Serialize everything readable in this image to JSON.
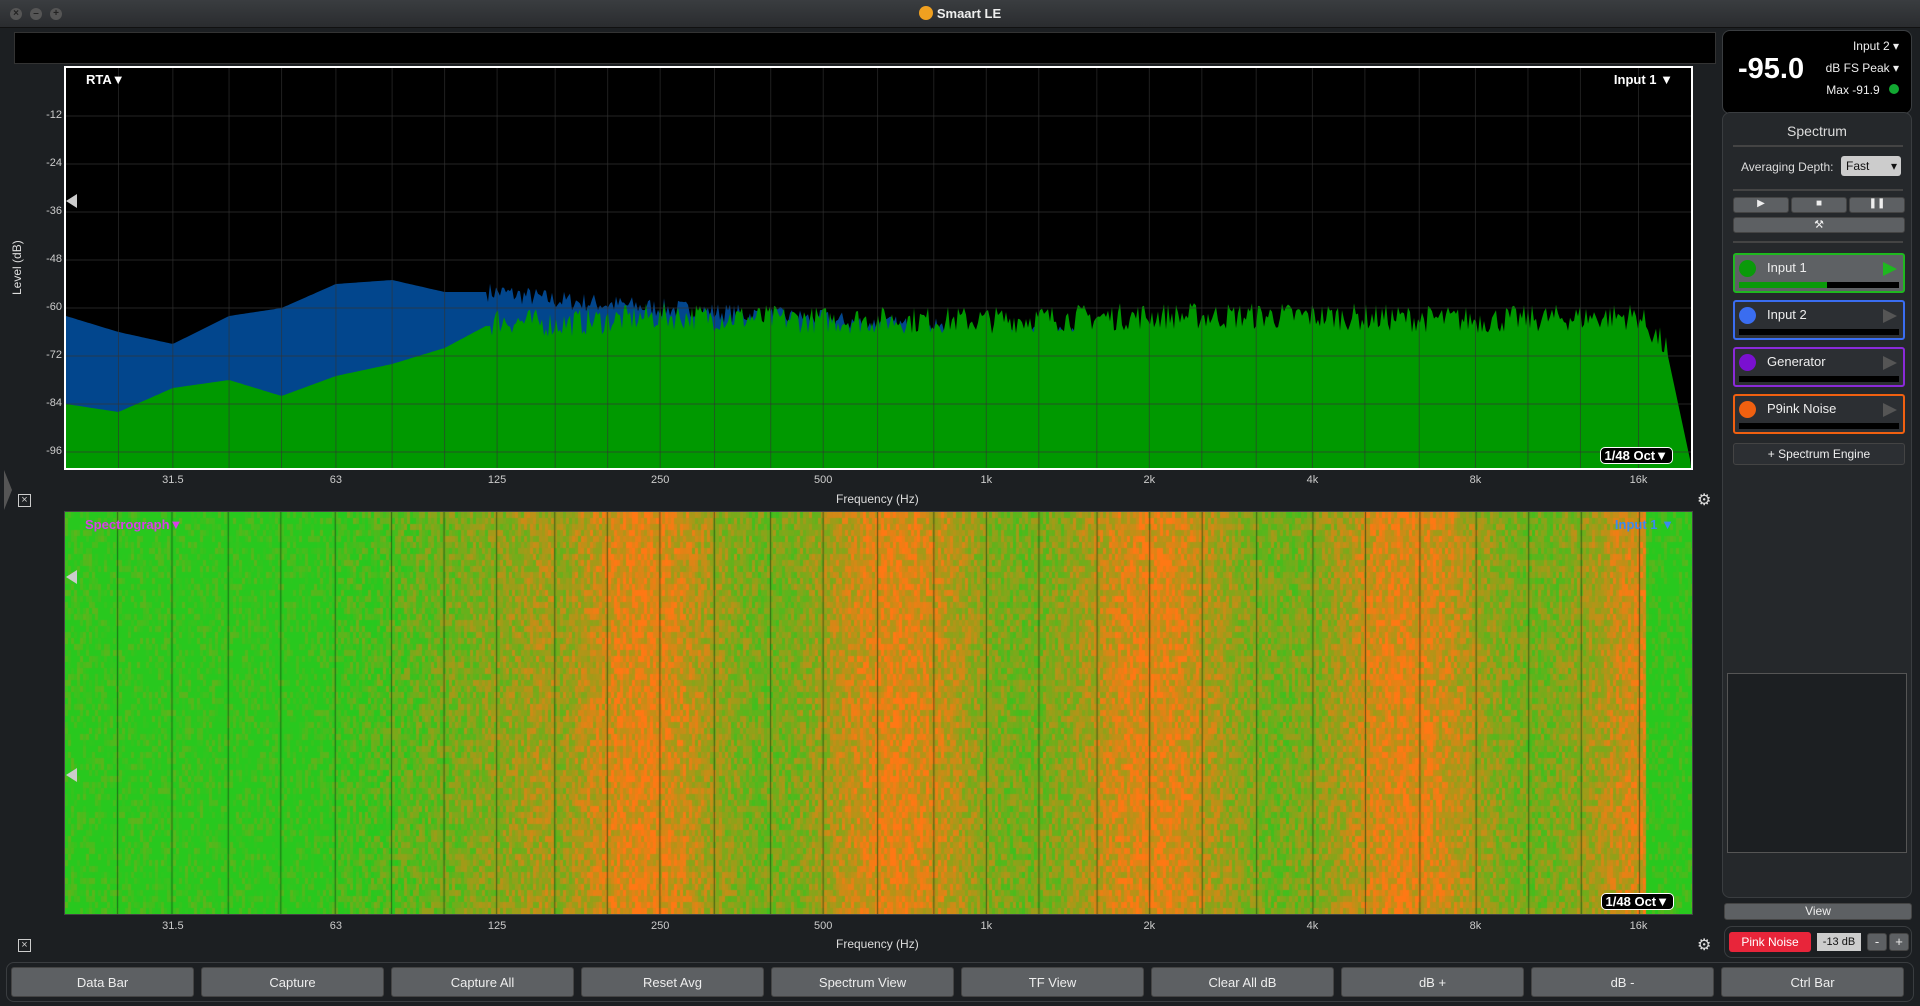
{
  "window": {
    "title": "Smaart LE"
  },
  "rta": {
    "mode_label": "RTA▼",
    "input_label": "Input 1 ▼",
    "resolution": "1/48 Oct▼",
    "ylabel": "Level (dB)",
    "xlabel": "Frequency (Hz)",
    "yticks": [
      "-12",
      "-24",
      "-36",
      "-48",
      "-60",
      "-72",
      "-84",
      "-96"
    ],
    "xticks": [
      "31.5",
      "63",
      "125",
      "250",
      "500",
      "1k",
      "2k",
      "4k",
      "8k",
      "16k"
    ]
  },
  "spectrograph": {
    "mode_label": "Spectrograph▼",
    "input_label": "Input 1 ▼",
    "resolution": "1/48 Oct▼",
    "xlabel": "Frequency (Hz)"
  },
  "chart_data": {
    "type": "area",
    "xlabel": "Frequency (Hz)",
    "ylabel": "Level (dB)",
    "xscale": "log",
    "xlim": [
      20,
      20000
    ],
    "ylim": [
      -100,
      0
    ],
    "grid": true,
    "x": [
      20,
      25,
      31.5,
      40,
      50,
      63,
      80,
      100,
      125,
      160,
      250,
      500,
      1000,
      2000,
      4000,
      8000,
      16000,
      18000,
      20000
    ],
    "series": [
      {
        "name": "Input 1",
        "color": "#009900",
        "values": [
          -84,
          -86,
          -80,
          -78,
          -82,
          -77,
          -74,
          -70,
          -63,
          -64,
          -62,
          -63,
          -63,
          -62,
          -62,
          -63,
          -62,
          -70,
          -99
        ]
      },
      {
        "name": "Input 2",
        "color": "#02468d",
        "values": [
          -62,
          -66,
          -69,
          -62,
          -60,
          -54,
          -53,
          -56,
          -56,
          -58,
          -60,
          -63,
          -66,
          -68,
          -70,
          -70,
          -72,
          -80,
          -99
        ]
      }
    ]
  },
  "meter": {
    "value": "-95.0",
    "source": "Input 2",
    "mode": "dB FS Peak",
    "max": "Max -91.9",
    "status_color": "#12a832"
  },
  "panel": {
    "title": "Spectrum",
    "avg_label": "Averaging Depth:",
    "avg_value": "Fast",
    "channels": [
      {
        "name": "Input 1",
        "color": "#0a9a0a",
        "border": "#1fb81f",
        "level": 0.55
      },
      {
        "name": "Input 2",
        "color": "#3a6df0",
        "border": "#3a6df0",
        "level": 0
      },
      {
        "name": "Generator",
        "color": "#7a10d0",
        "border": "#8a2ad8",
        "level": 0
      },
      {
        "name": "P9ink Noise",
        "color": "#f06010",
        "border": "#f06010",
        "level": 0
      }
    ],
    "add_engine": "+ Spectrum Engine",
    "view": "View",
    "generator_button": "Pink Noise",
    "generator_level": "-13 dB",
    "minus": "-",
    "plus": "+"
  },
  "toolbar": [
    "Data Bar",
    "Capture",
    "Capture All",
    "Reset Avg",
    "Spectrum View",
    "TF View",
    "Clear All dB",
    "dB +",
    "dB -",
    "Ctrl Bar"
  ]
}
